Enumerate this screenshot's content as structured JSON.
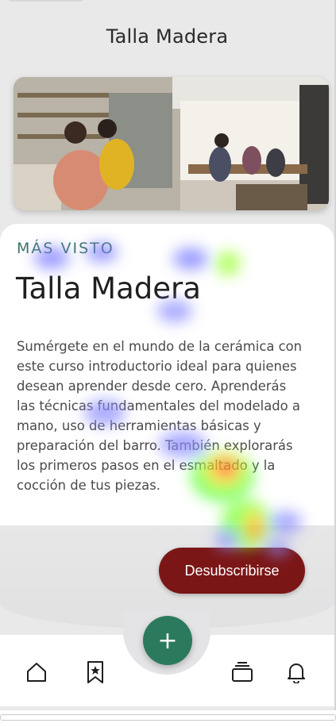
{
  "header": {
    "title": "Talla Madera"
  },
  "hero": {
    "image_alt": "Ceramics workshop"
  },
  "card": {
    "eyebrow": "MÁS VISTO",
    "title": "Talla Madera",
    "description": "Sumérgete en el mundo de la cerámica con este curso introductorio ideal para quienes desean aprender desde cero. Aprenderás las técnicas fundamentales del modelado a mano, uso de herramientas básicas y preparación del barro. También explorarás los primeros pasos en el esmaltado y la cocción de tus piezas."
  },
  "actions": {
    "unsubscribe_label": "Desubscribirse",
    "fab_label": "+"
  },
  "nav": {
    "items": [
      {
        "icon": "home-icon"
      },
      {
        "icon": "bookmark-star-icon"
      },
      {
        "icon": "stack-icon"
      },
      {
        "icon": "bell-icon"
      }
    ]
  },
  "colors": {
    "accent_green": "#2b7a5e",
    "eyebrow_green": "#3c7764",
    "button_red": "#7b1616",
    "background": "#e9e9ea"
  }
}
